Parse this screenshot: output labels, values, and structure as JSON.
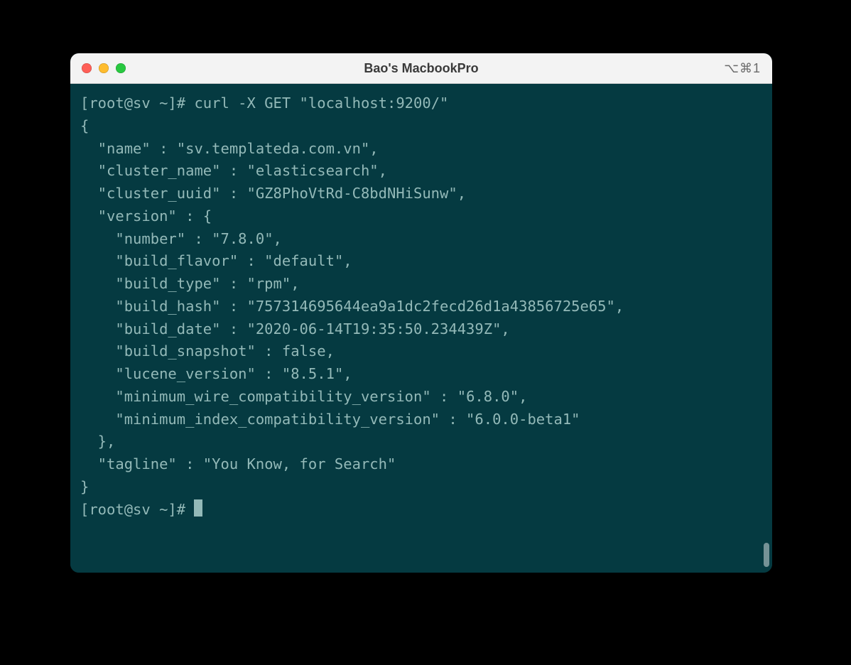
{
  "window": {
    "title": "Bao's MacbookPro",
    "hotkey": "⌥⌘1"
  },
  "traffic_lights": {
    "close": "close",
    "minimize": "minimize",
    "maximize": "maximize"
  },
  "terminal": {
    "prompt1": "[root@sv ~]# ",
    "command": "curl -X GET \"localhost:9200/\"",
    "prompt2": "[root@sv ~]# ",
    "response": {
      "name": "sv.templateda.com.vn",
      "cluster_name": "elasticsearch",
      "cluster_uuid": "GZ8PhoVtRd-C8bdNHiSunw",
      "version": {
        "number": "7.8.0",
        "build_flavor": "default",
        "build_type": "rpm",
        "build_hash": "757314695644ea9a1dc2fecd26d1a43856725e65",
        "build_date": "2020-06-14T19:35:50.234439Z",
        "build_snapshot": "false",
        "lucene_version": "8.5.1",
        "minimum_wire_compatibility_version": "6.8.0",
        "minimum_index_compatibility_version": "6.0.0-beta1"
      },
      "tagline": "You Know, for Search"
    }
  }
}
